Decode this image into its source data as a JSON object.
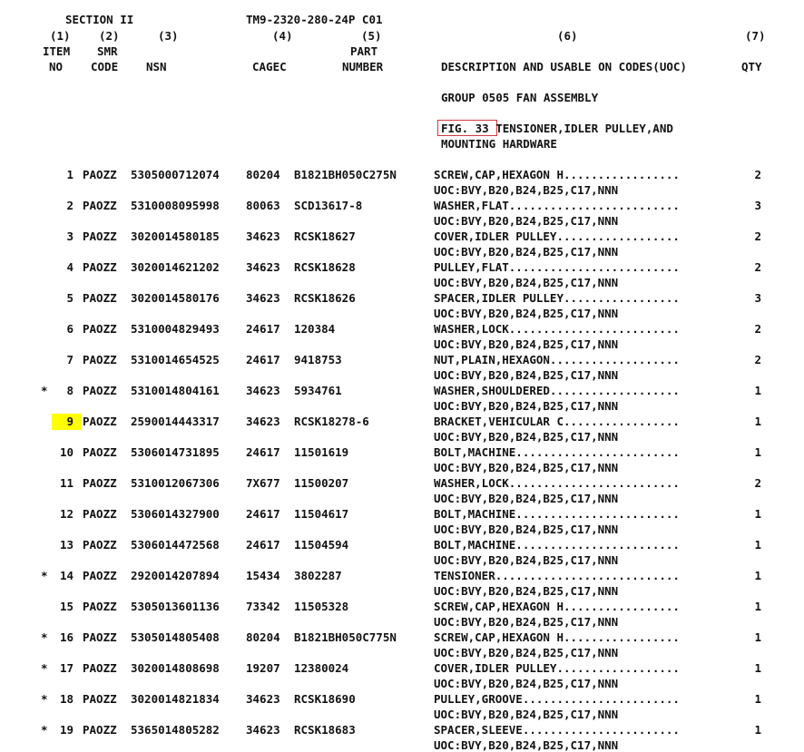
{
  "header": {
    "section": "SECTION II",
    "doc_number": "TM9-2320-280-24P C01",
    "col_nums": [
      "(1)",
      "(2)",
      "(3)",
      "(4)",
      "(5)",
      "(6)",
      "(7)"
    ],
    "col_row2": {
      "item": "ITEM",
      "smr": "SMR",
      "part": "PART"
    },
    "col_row3": {
      "no": "NO",
      "code": "CODE",
      "nsn": "NSN",
      "cagec": "CAGEC",
      "number": "NUMBER",
      "desc": "DESCRIPTION AND USABLE ON CODES(UOC)",
      "qty": "QTY"
    }
  },
  "group": "GROUP 0505 FAN ASSEMBLY",
  "figure": {
    "ref": "FIG. 33",
    "title_line1": " TENSIONER,IDLER PULLEY,AND",
    "title_line2": "MOUNTING HARDWARE"
  },
  "uoc": "UOC:BVY,B20,B24,B25,C17,NNN",
  "rows": [
    {
      "mark": "",
      "item": "1",
      "smr": "PAOZZ",
      "nsn": "5305000712074",
      "cagec": "80204",
      "part": "B1821BH050C275N",
      "desc": "SCREW,CAP,HEXAGON H.................",
      "qty": "2"
    },
    {
      "mark": "",
      "item": "2",
      "smr": "PAOZZ",
      "nsn": "5310008095998",
      "cagec": "80063",
      "part": "SCD13617-8",
      "desc": "WASHER,FLAT.........................",
      "qty": "3"
    },
    {
      "mark": "",
      "item": "3",
      "smr": "PAOZZ",
      "nsn": "3020014580185",
      "cagec": "34623",
      "part": "RCSK18627",
      "desc": "COVER,IDLER PULLEY..................",
      "qty": "2"
    },
    {
      "mark": "",
      "item": "4",
      "smr": "PAOZZ",
      "nsn": "3020014621202",
      "cagec": "34623",
      "part": "RCSK18628",
      "desc": "PULLEY,FLAT.........................",
      "qty": "2"
    },
    {
      "mark": "",
      "item": "5",
      "smr": "PAOZZ",
      "nsn": "3020014580176",
      "cagec": "34623",
      "part": "RCSK18626",
      "desc": "SPACER,IDLER PULLEY.................",
      "qty": "3"
    },
    {
      "mark": "",
      "item": "6",
      "smr": "PAOZZ",
      "nsn": "5310004829493",
      "cagec": "24617",
      "part": "120384",
      "desc": "WASHER,LOCK.........................",
      "qty": "2"
    },
    {
      "mark": "",
      "item": "7",
      "smr": "PAOZZ",
      "nsn": "5310014654525",
      "cagec": "24617",
      "part": "9418753",
      "desc": "NUT,PLAIN,HEXAGON...................",
      "qty": "2"
    },
    {
      "mark": "*",
      "item": "8",
      "smr": "PAOZZ",
      "nsn": "5310014804161",
      "cagec": "34623",
      "part": "5934761",
      "desc": "WASHER,SHOULDERED...................",
      "qty": "1"
    },
    {
      "mark": "",
      "item": "9",
      "smr": "PAOZZ",
      "nsn": "2590014443317",
      "cagec": "34623",
      "part": "RCSK18278-6",
      "desc": "BRACKET,VEHICULAR C.................",
      "qty": "1",
      "highlight": true
    },
    {
      "mark": "",
      "item": "10",
      "smr": "PAOZZ",
      "nsn": "5306014731895",
      "cagec": "24617",
      "part": "11501619",
      "desc": "BOLT,MACHINE........................",
      "qty": "1"
    },
    {
      "mark": "",
      "item": "11",
      "smr": "PAOZZ",
      "nsn": "5310012067306",
      "cagec": "7X677",
      "part": "11500207",
      "desc": "WASHER,LOCK.........................",
      "qty": "2"
    },
    {
      "mark": "",
      "item": "12",
      "smr": "PAOZZ",
      "nsn": "5306014327900",
      "cagec": "24617",
      "part": "11504617",
      "desc": "BOLT,MACHINE........................",
      "qty": "1"
    },
    {
      "mark": "",
      "item": "13",
      "smr": "PAOZZ",
      "nsn": "5306014472568",
      "cagec": "24617",
      "part": "11504594",
      "desc": "BOLT,MACHINE........................",
      "qty": "1"
    },
    {
      "mark": "*",
      "item": "14",
      "smr": "PAOZZ",
      "nsn": "2920014207894",
      "cagec": "15434",
      "part": "3802287",
      "desc": "TENSIONER...........................",
      "qty": "1"
    },
    {
      "mark": "",
      "item": "15",
      "smr": "PAOZZ",
      "nsn": "5305013601136",
      "cagec": "73342",
      "part": "11505328",
      "desc": "SCREW,CAP,HEXAGON H.................",
      "qty": "1"
    },
    {
      "mark": "*",
      "item": "16",
      "smr": "PAOZZ",
      "nsn": "5305014805408",
      "cagec": "80204",
      "part": "B1821BH050C775N",
      "desc": "SCREW,CAP,HEXAGON H.................",
      "qty": "1"
    },
    {
      "mark": "*",
      "item": "17",
      "smr": "PAOZZ",
      "nsn": "3020014808698",
      "cagec": "19207",
      "part": "12380024",
      "desc": "COVER,IDLER PULLEY..................",
      "qty": "1"
    },
    {
      "mark": "*",
      "item": "18",
      "smr": "PAOZZ",
      "nsn": "3020014821834",
      "cagec": "34623",
      "part": "RCSK18690",
      "desc": "PULLEY,GROOVE.......................",
      "qty": "1"
    },
    {
      "mark": "*",
      "item": "19",
      "smr": "PAOZZ",
      "nsn": "5365014805282",
      "cagec": "34623",
      "part": "RCSK18683",
      "desc": "SPACER,SLEEVE.......................",
      "qty": "1"
    }
  ]
}
